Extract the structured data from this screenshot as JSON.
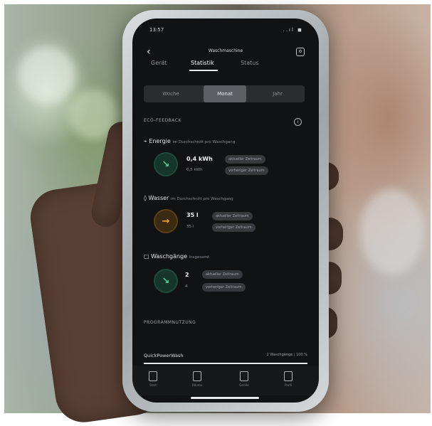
{
  "status_bar": {
    "time": "13:57",
    "system": "..ıl ◼"
  },
  "header": {
    "title": "Waschmaschine",
    "back_icon": "chevron-left-icon",
    "more_icon": "settings-icon"
  },
  "tabs": [
    "Gerät",
    "Statistik",
    "Status"
  ],
  "segments": [
    "Woche",
    "Monat",
    "Jahr"
  ],
  "eco": {
    "section_title": "ECO-FEEDBACK",
    "energy": {
      "label": "Energie",
      "note": "im Durchschnitt pro Waschgang",
      "value": "0,4 kWh",
      "sub": "0,5 kWh",
      "pill1": "aktueller Zeitraum",
      "pill2": "vorheriger Zeitraum",
      "trend_icon": "arrow-down-right-icon"
    },
    "water": {
      "label": "Wasser",
      "note": "im Durchschnitt pro Waschgang",
      "value": "35 l",
      "sub": "35 l",
      "pill1": "aktueller Zeitraum",
      "pill2": "vorheriger Zeitraum",
      "trend_icon": "arrow-right-icon"
    },
    "cycles": {
      "label": "Waschgänge",
      "note": "insgesamt",
      "value": "2",
      "sub": "4",
      "pill1": "aktueller Zeitraum",
      "pill2": "vorheriger Zeitraum",
      "trend_icon": "arrow-down-right-icon"
    }
  },
  "program_usage": {
    "section_title": "PROGRAMMNUTZUNG",
    "item": "QuickPowerWash",
    "detail": "2 Waschgänge | 100 %",
    "share": 1.0
  },
  "nav": [
    "Start",
    "Räume",
    "Geräte",
    "Profil"
  ],
  "colors": {
    "green": "#4ed197",
    "orange": "#f1a33a",
    "screen_bg": "#111214"
  }
}
